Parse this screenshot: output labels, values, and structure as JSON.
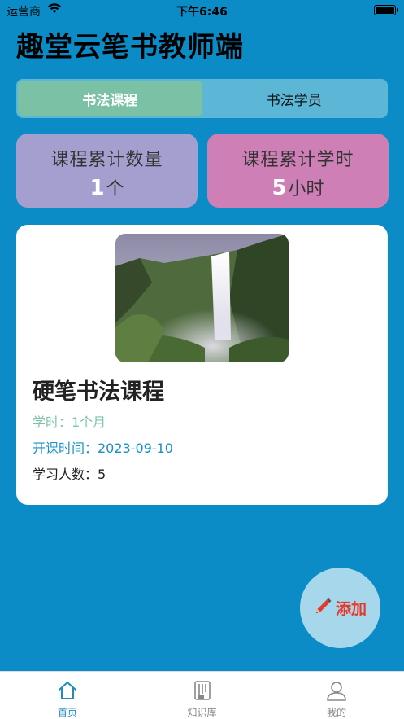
{
  "status_bar": {
    "carrier": "运营商",
    "time": "下午6:46"
  },
  "app": {
    "title": "趣堂云笔书教师端"
  },
  "tabs": [
    {
      "label": "书法课程",
      "active": true
    },
    {
      "label": "书法学员",
      "active": false
    }
  ],
  "stats": {
    "course_count": {
      "label": "课程累计数量",
      "value": "1",
      "unit": "个"
    },
    "course_hours": {
      "label": "课程累计学时",
      "value": "5",
      "unit": "小时"
    }
  },
  "course_card": {
    "title": "硬笔书法课程",
    "duration": "学时：1个月",
    "start_time": "开课时间：2023-09-10",
    "students": "学习人数：5",
    "cover_icon": "waterfall-image"
  },
  "fab": {
    "label": "添加",
    "icon": "pencil-icon"
  },
  "tabbar": [
    {
      "label": "首页",
      "icon": "home-icon",
      "active": true
    },
    {
      "label": "知识库",
      "icon": "library-icon",
      "active": false
    },
    {
      "label": "我的",
      "icon": "profile-icon",
      "active": false
    }
  ],
  "colors": {
    "background": "#0b8cc6",
    "tab_active": "#7ac1a6",
    "stat_left": "#a59fd0",
    "stat_right": "#cd7fb6",
    "accent": "#1b8fc2",
    "fab_text": "#e23a2f"
  }
}
